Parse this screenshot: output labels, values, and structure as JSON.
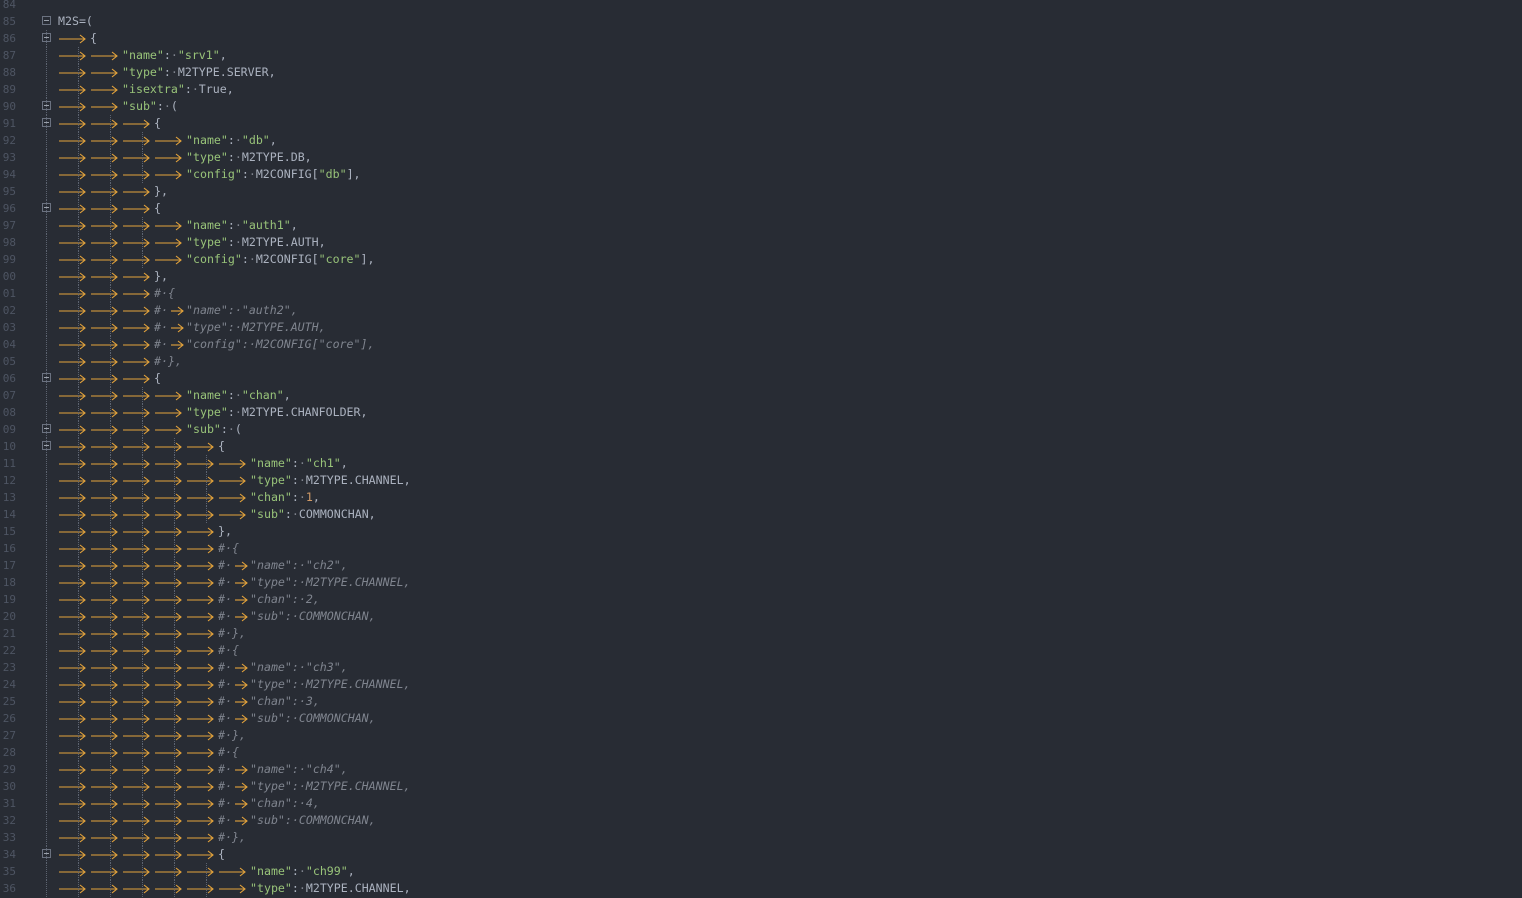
{
  "colors": {
    "background": "#282c34",
    "string": "#98c379",
    "punct": "#abb2bf",
    "arrow": "#e5a43c",
    "comment": "#7f848e",
    "lineno": "#4e5563"
  },
  "lines": [
    {
      "n": "84",
      "d": 0,
      "t": ""
    },
    {
      "n": "85",
      "d": 0,
      "fold": true,
      "t": [
        [
          "p",
          "M2S=("
        ]
      ]
    },
    {
      "n": "86",
      "d": 1,
      "fold": true,
      "t": [
        [
          "p",
          "{"
        ]
      ]
    },
    {
      "n": "87",
      "d": 2,
      "t": [
        [
          "s",
          "\"name\""
        ],
        [
          "p",
          ":"
        ],
        [
          "d",
          "·"
        ],
        [
          "s",
          "\"srv1\""
        ],
        [
          "p",
          ","
        ]
      ]
    },
    {
      "n": "88",
      "d": 2,
      "t": [
        [
          "s",
          "\"type\""
        ],
        [
          "p",
          ":"
        ],
        [
          "d",
          "·"
        ],
        [
          "p",
          "M2TYPE.SERVER,"
        ]
      ]
    },
    {
      "n": "89",
      "d": 2,
      "t": [
        [
          "s",
          "\"isextra\""
        ],
        [
          "p",
          ":"
        ],
        [
          "d",
          "·"
        ],
        [
          "p",
          "True,"
        ]
      ]
    },
    {
      "n": "90",
      "d": 2,
      "fold": true,
      "t": [
        [
          "s",
          "\"sub\""
        ],
        [
          "p",
          ":"
        ],
        [
          "d",
          "·"
        ],
        [
          "p",
          "("
        ]
      ]
    },
    {
      "n": "91",
      "d": 3,
      "fold": true,
      "t": [
        [
          "p",
          "{"
        ]
      ]
    },
    {
      "n": "92",
      "d": 4,
      "t": [
        [
          "s",
          "\"name\""
        ],
        [
          "p",
          ":"
        ],
        [
          "d",
          "·"
        ],
        [
          "s",
          "\"db\""
        ],
        [
          "p",
          ","
        ]
      ]
    },
    {
      "n": "93",
      "d": 4,
      "t": [
        [
          "s",
          "\"type\""
        ],
        [
          "p",
          ":"
        ],
        [
          "d",
          "·"
        ],
        [
          "p",
          "M2TYPE.DB,"
        ]
      ]
    },
    {
      "n": "94",
      "d": 4,
      "t": [
        [
          "s",
          "\"config\""
        ],
        [
          "p",
          ":"
        ],
        [
          "d",
          "·"
        ],
        [
          "p",
          "M2CONFIG["
        ],
        [
          "s",
          "\"db\""
        ],
        [
          "p",
          "],"
        ]
      ]
    },
    {
      "n": "95",
      "d": 3,
      "t": [
        [
          "p",
          "},"
        ]
      ]
    },
    {
      "n": "96",
      "d": 3,
      "fold": true,
      "t": [
        [
          "p",
          "{"
        ]
      ]
    },
    {
      "n": "97",
      "d": 4,
      "t": [
        [
          "s",
          "\"name\""
        ],
        [
          "p",
          ":"
        ],
        [
          "d",
          "·"
        ],
        [
          "s",
          "\"auth1\""
        ],
        [
          "p",
          ","
        ]
      ]
    },
    {
      "n": "98",
      "d": 4,
      "t": [
        [
          "s",
          "\"type\""
        ],
        [
          "p",
          ":"
        ],
        [
          "d",
          "·"
        ],
        [
          "p",
          "M2TYPE.AUTH,"
        ]
      ]
    },
    {
      "n": "99",
      "d": 4,
      "t": [
        [
          "s",
          "\"config\""
        ],
        [
          "p",
          ":"
        ],
        [
          "d",
          "·"
        ],
        [
          "p",
          "M2CONFIG["
        ],
        [
          "s",
          "\"core\""
        ],
        [
          "p",
          "],"
        ]
      ]
    },
    {
      "n": "00",
      "d": 3,
      "t": [
        [
          "p",
          "},"
        ]
      ]
    },
    {
      "n": "01",
      "d": 3,
      "t": [
        [
          "c",
          "#·{"
        ]
      ]
    },
    {
      "n": "02",
      "d": 3,
      "cm": true,
      "t": [
        [
          "c",
          "\"name\":·\"auth2\","
        ]
      ]
    },
    {
      "n": "03",
      "d": 3,
      "cm": true,
      "t": [
        [
          "c",
          "\"type\":·M2TYPE.AUTH,"
        ]
      ]
    },
    {
      "n": "04",
      "d": 3,
      "cm": true,
      "t": [
        [
          "c",
          "\"config\":·M2CONFIG[\"core\"],"
        ]
      ]
    },
    {
      "n": "05",
      "d": 3,
      "t": [
        [
          "c",
          "#·},"
        ]
      ]
    },
    {
      "n": "06",
      "d": 3,
      "fold": true,
      "t": [
        [
          "p",
          "{"
        ]
      ]
    },
    {
      "n": "07",
      "d": 4,
      "t": [
        [
          "s",
          "\"name\""
        ],
        [
          "p",
          ":"
        ],
        [
          "d",
          "·"
        ],
        [
          "s",
          "\"chan\""
        ],
        [
          "p",
          ","
        ]
      ]
    },
    {
      "n": "08",
      "d": 4,
      "t": [
        [
          "s",
          "\"type\""
        ],
        [
          "p",
          ":"
        ],
        [
          "d",
          "·"
        ],
        [
          "p",
          "M2TYPE.CHANFOLDER,"
        ]
      ]
    },
    {
      "n": "09",
      "d": 4,
      "fold": true,
      "t": [
        [
          "s",
          "\"sub\""
        ],
        [
          "p",
          ":"
        ],
        [
          "d",
          "·"
        ],
        [
          "p",
          "("
        ]
      ]
    },
    {
      "n": "10",
      "d": 5,
      "fold": true,
      "t": [
        [
          "p",
          "{"
        ]
      ]
    },
    {
      "n": "11",
      "d": 6,
      "t": [
        [
          "s",
          "\"name\""
        ],
        [
          "p",
          ":"
        ],
        [
          "d",
          "·"
        ],
        [
          "s",
          "\"ch1\""
        ],
        [
          "p",
          ","
        ]
      ]
    },
    {
      "n": "12",
      "d": 6,
      "t": [
        [
          "s",
          "\"type\""
        ],
        [
          "p",
          ":"
        ],
        [
          "d",
          "·"
        ],
        [
          "p",
          "M2TYPE.CHANNEL,"
        ]
      ]
    },
    {
      "n": "13",
      "d": 6,
      "t": [
        [
          "s",
          "\"chan\""
        ],
        [
          "p",
          ":"
        ],
        [
          "d",
          "·"
        ],
        [
          "k",
          "1"
        ],
        [
          "p",
          ","
        ]
      ]
    },
    {
      "n": "14",
      "d": 6,
      "t": [
        [
          "s",
          "\"sub\""
        ],
        [
          "p",
          ":"
        ],
        [
          "d",
          "·"
        ],
        [
          "p",
          "COMMONCHAN,"
        ]
      ]
    },
    {
      "n": "15",
      "d": 5,
      "t": [
        [
          "p",
          "},"
        ]
      ]
    },
    {
      "n": "16",
      "d": 5,
      "t": [
        [
          "c",
          "#·{"
        ]
      ]
    },
    {
      "n": "17",
      "d": 5,
      "cm": true,
      "t": [
        [
          "c",
          "\"name\":·\"ch2\","
        ]
      ]
    },
    {
      "n": "18",
      "d": 5,
      "cm": true,
      "t": [
        [
          "c",
          "\"type\":·M2TYPE.CHANNEL,"
        ]
      ]
    },
    {
      "n": "19",
      "d": 5,
      "cm": true,
      "t": [
        [
          "c",
          "\"chan\":·2,"
        ]
      ]
    },
    {
      "n": "20",
      "d": 5,
      "cm": true,
      "t": [
        [
          "c",
          "\"sub\":·COMMONCHAN,"
        ]
      ]
    },
    {
      "n": "21",
      "d": 5,
      "t": [
        [
          "c",
          "#·},"
        ]
      ]
    },
    {
      "n": "22",
      "d": 5,
      "t": [
        [
          "c",
          "#·{"
        ]
      ]
    },
    {
      "n": "23",
      "d": 5,
      "cm": true,
      "t": [
        [
          "c",
          "\"name\":·\"ch3\","
        ]
      ]
    },
    {
      "n": "24",
      "d": 5,
      "cm": true,
      "t": [
        [
          "c",
          "\"type\":·M2TYPE.CHANNEL,"
        ]
      ]
    },
    {
      "n": "25",
      "d": 5,
      "cm": true,
      "t": [
        [
          "c",
          "\"chan\":·3,"
        ]
      ]
    },
    {
      "n": "26",
      "d": 5,
      "cm": true,
      "t": [
        [
          "c",
          "\"sub\":·COMMONCHAN,"
        ]
      ]
    },
    {
      "n": "27",
      "d": 5,
      "t": [
        [
          "c",
          "#·},"
        ]
      ]
    },
    {
      "n": "28",
      "d": 5,
      "t": [
        [
          "c",
          "#·{"
        ]
      ]
    },
    {
      "n": "29",
      "d": 5,
      "cm": true,
      "t": [
        [
          "c",
          "\"name\":·\"ch4\","
        ]
      ]
    },
    {
      "n": "30",
      "d": 5,
      "cm": true,
      "t": [
        [
          "c",
          "\"type\":·M2TYPE.CHANNEL,"
        ]
      ]
    },
    {
      "n": "31",
      "d": 5,
      "cm": true,
      "t": [
        [
          "c",
          "\"chan\":·4,"
        ]
      ]
    },
    {
      "n": "32",
      "d": 5,
      "cm": true,
      "t": [
        [
          "c",
          "\"sub\":·COMMONCHAN,"
        ]
      ]
    },
    {
      "n": "33",
      "d": 5,
      "t": [
        [
          "c",
          "#·},"
        ]
      ]
    },
    {
      "n": "34",
      "d": 5,
      "fold": true,
      "t": [
        [
          "p",
          "{"
        ]
      ]
    },
    {
      "n": "35",
      "d": 6,
      "t": [
        [
          "s",
          "\"name\""
        ],
        [
          "p",
          ":"
        ],
        [
          "d",
          "·"
        ],
        [
          "s",
          "\"ch99\""
        ],
        [
          "p",
          ","
        ]
      ]
    },
    {
      "n": "36",
      "d": 6,
      "t": [
        [
          "s",
          "\"type\""
        ],
        [
          "p",
          ":"
        ],
        [
          "d",
          "·"
        ],
        [
          "p",
          "M2TYPE.CHANNEL,"
        ]
      ]
    }
  ]
}
